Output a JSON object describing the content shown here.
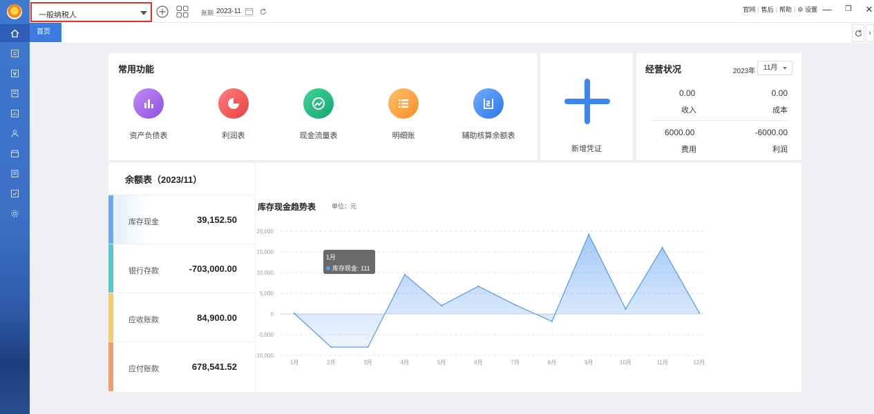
{
  "toolbar": {
    "company_name": "一般纳税人",
    "period_label": "账期",
    "period_value": "2023-11",
    "links": [
      "官网",
      "售后",
      "帮助"
    ],
    "settings_label": "设置",
    "window_minimize": "—",
    "window_restore": "❐",
    "window_close": "✕"
  },
  "tabs": {
    "home_label": "首页",
    "next_label": "›"
  },
  "common": {
    "title": "常用功能",
    "items": [
      {
        "label": "资产负债表",
        "icon": "bar-chart-icon",
        "color": "#a367e8"
      },
      {
        "label": "利润表",
        "icon": "pie-chart-icon",
        "color": "#f25a5a"
      },
      {
        "label": "现金流量表",
        "icon": "trend-icon",
        "color": "#1fb87a"
      },
      {
        "label": "明细账",
        "icon": "list-icon",
        "color": "#f7a13b"
      },
      {
        "label": "辅助核算余额表",
        "icon": "ledger-icon",
        "color": "#3d86ee"
      }
    ]
  },
  "voucher": {
    "label": "新增凭证"
  },
  "business": {
    "title": "经营状况",
    "year": "2023年",
    "month": "11月",
    "income_value": "0.00",
    "income_label": "收入",
    "cost_value": "0.00",
    "cost_label": "成本",
    "expense_value": "6000.00",
    "expense_label": "费用",
    "profit_value": "-6000.00",
    "profit_label": "利润"
  },
  "balance": {
    "title": "余额表（2023/11）",
    "rows": [
      {
        "label": "库存现金",
        "value": "39,152.50",
        "color": "#6aa8f5"
      },
      {
        "label": "银行存款",
        "value": "-703,000.00",
        "color": "#4ecbcf"
      },
      {
        "label": "应收账款",
        "value": "84,900.00",
        "color": "#f6cd62"
      },
      {
        "label": "应付账款",
        "value": "678,541.52",
        "color": "#f59a6a"
      }
    ]
  },
  "chart": {
    "title": "库存现金趋势表",
    "unit": "单位：元",
    "tooltip_month": "1月",
    "tooltip_text": "库存现金: 111"
  },
  "chart_data": {
    "type": "area",
    "categories": [
      "1月",
      "2月",
      "3月",
      "4月",
      "5月",
      "6月",
      "7月",
      "8月",
      "9月",
      "10月",
      "11月",
      "12月"
    ],
    "series": [
      {
        "name": "库存现金",
        "values": [
          111,
          -8000,
          -8000,
          9500,
          2000,
          6700,
          2200,
          -1800,
          19200,
          1200,
          16000,
          300
        ]
      }
    ],
    "ylim": [
      -10000,
      20000
    ],
    "yticks": [
      -10000,
      -5000,
      0,
      5000,
      10000,
      15000,
      20000
    ],
    "ytick_labels": [
      "-10,000",
      "-5,000",
      "0",
      "5,000",
      "10,000",
      "15,000",
      "20,000"
    ],
    "grid": true,
    "color": "#5a9cf0"
  }
}
